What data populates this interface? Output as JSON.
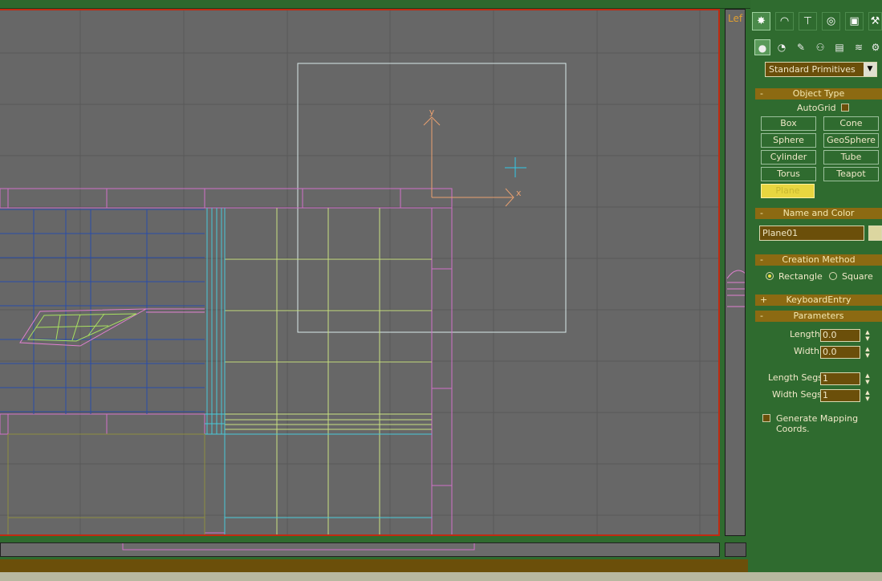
{
  "viewport": {
    "label": "Lef"
  },
  "panel": {
    "tabs": [
      "create-icon",
      "modify-icon",
      "hierarchy-icon",
      "motion-icon",
      "display-icon",
      "utilities-icon"
    ],
    "subtabs": [
      "geometry-icon",
      "shapes-icon",
      "lights-icon",
      "cameras-icon",
      "helpers-icon",
      "spacewarps-icon",
      "systems-icon"
    ],
    "category": "Standard Primitives",
    "object_type": {
      "title": "Object Type",
      "autogrid": "AutoGrid",
      "buttons": [
        "Box",
        "Cone",
        "Sphere",
        "GeoSphere",
        "Cylinder",
        "Tube",
        "Torus",
        "Teapot",
        "Plane"
      ]
    },
    "name_color": {
      "title": "Name and Color",
      "name": "Plane01",
      "color": "#dcd6a0"
    },
    "creation_method": {
      "title": "Creation Method",
      "rectangle": "Rectangle",
      "square": "Square",
      "selected": "Rectangle"
    },
    "keyboard_entry": {
      "title": "KeyboardEntry"
    },
    "parameters": {
      "title": "Parameters",
      "length_label": "Length:",
      "length": "0.0",
      "width_label": "Width:",
      "width": "0.0",
      "length_segs_label": "Length Segs:",
      "length_segs": "1",
      "width_segs_label": "Width Segs:",
      "width_segs": "1",
      "mapping": "Generate Mapping Coords."
    }
  },
  "gizmo": {
    "y_label": "y",
    "x_label": "x"
  }
}
